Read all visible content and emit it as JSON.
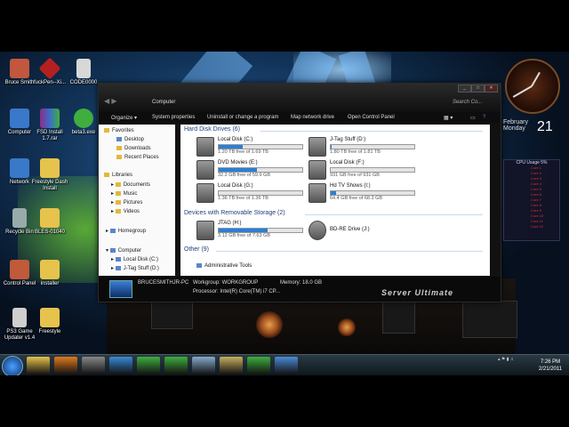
{
  "desktop_icons": [
    {
      "label": "Bruce Smith",
      "color": "#c0573e"
    },
    {
      "label": "fuckPen--Xi...",
      "color": "#b42020"
    },
    {
      "label": "CODE0000",
      "color": "#d8d8d8"
    },
    {
      "label": "Computer",
      "color": "#3a78c9"
    },
    {
      "label": "FSD Install 1.7.rar",
      "color": "#8a2d8a"
    },
    {
      "label": "beta3.exe",
      "color": "#3fae3f"
    },
    {
      "label": "Network",
      "color": "#3a78c9"
    },
    {
      "label": "Freestyle Dash Install",
      "color": "#e6c34c"
    },
    {
      "label": "Recycle Bin",
      "color": "#9aa"
    },
    {
      "label": "BLES-01040",
      "color": "#e6c34c"
    },
    {
      "label": "Control Panel",
      "color": "#c05a3a"
    },
    {
      "label": "installer",
      "color": "#e6c34c"
    },
    {
      "label": "PS3 Game Updater v1.4",
      "color": "#cfcfcf"
    },
    {
      "label": "Freestyle",
      "color": "#e6c34c"
    }
  ],
  "window": {
    "address": "Computer",
    "search_placeholder": "Search Co...",
    "toolbar": [
      "Organize ▾",
      "System properties",
      "Uninstall or change a program",
      "Map network drive",
      "Open Control Panel"
    ],
    "nav": {
      "favorites": "Favorites",
      "favorites_items": [
        "Desktop",
        "Downloads",
        "Recent Places"
      ],
      "libraries": "Libraries",
      "library_items": [
        "Documents",
        "Music",
        "Pictures",
        "Videos"
      ],
      "homegroup": "Homegroup",
      "computer": "Computer",
      "computer_items": [
        "Local Disk (C:)",
        "J-Tag Stuff (D:)"
      ]
    },
    "groups": {
      "hdd": "Hard Disk Drives (6)",
      "removable": "Devices with Removable Storage (2)",
      "other": "Other (9)"
    },
    "drives": [
      {
        "name": "Local Disk (C:)",
        "free": "1.20 TB free of 1.69 TB",
        "used_fraction": 0.29
      },
      {
        "name": "J-Tag Stuff (D:)",
        "free": "1.80 TB free of 1.81 TB",
        "used_fraction": 0.01
      },
      {
        "name": "DVD Movies (E:)",
        "free": "32.2 GB free of 59.9 GB",
        "used_fraction": 0.46
      },
      {
        "name": "Local Disk (F:)",
        "free": "931 GB free of 931 GB",
        "used_fraction": 0.0
      },
      {
        "name": "Local Disk (G:)",
        "free": "1.36 TB free of 1.36 TB",
        "used_fraction": 0.0
      },
      {
        "name": "Hd TV Shows (I:)",
        "free": "64.4 GB free of 68.3 GB",
        "used_fraction": 0.06
      }
    ],
    "removable": [
      {
        "name": "JTAG (H:)",
        "free": "3.12 GB free of 7.63 GB",
        "used_fraction": 0.59
      },
      {
        "name": "BD-RE Drive (J:)"
      }
    ],
    "other_items": [
      "Administrative Tools"
    ],
    "status": {
      "pc_name": "BRUCESMITHJR-PC",
      "workgroup": "Workgroup: WORKGROUP",
      "memory": "Memory: 18.0 GB",
      "processor": "Processor: Intel(R) Core(TM) i7 CP..."
    },
    "banner": "Server Ultimate"
  },
  "gadgets": {
    "calendar_month": "February",
    "calendar_day_name": "Monday",
    "calendar_day": "21",
    "cpu_title": "CPU Usage",
    "cpu_pct": "5%",
    "cpu_cores": [
      "Core 1",
      "Core 2",
      "Core 3",
      "Core 4",
      "Core 5",
      "Core 6",
      "Core 7",
      "Core 8",
      "Core 9",
      "Core 10",
      "Core 11",
      "Core 12"
    ]
  },
  "taskbar": {
    "time": "7:26 PM",
    "date": "2/21/2011",
    "buttons": [
      {
        "name": "explorer",
        "color": "#e6c34c"
      },
      {
        "name": "firefox",
        "color": "#e07a20"
      },
      {
        "name": "media",
        "color": "#888"
      },
      {
        "name": "ie",
        "color": "#3a8ad6"
      },
      {
        "name": "xbox",
        "color": "#3fae3f"
      },
      {
        "name": "tool",
        "color": "#3fae3f"
      },
      {
        "name": "paint",
        "color": "#8ac"
      },
      {
        "name": "folder",
        "color": "#c8b060"
      },
      {
        "name": "active",
        "color": "#3fae3f"
      },
      {
        "name": "app",
        "color": "#4a8ad6"
      }
    ]
  }
}
